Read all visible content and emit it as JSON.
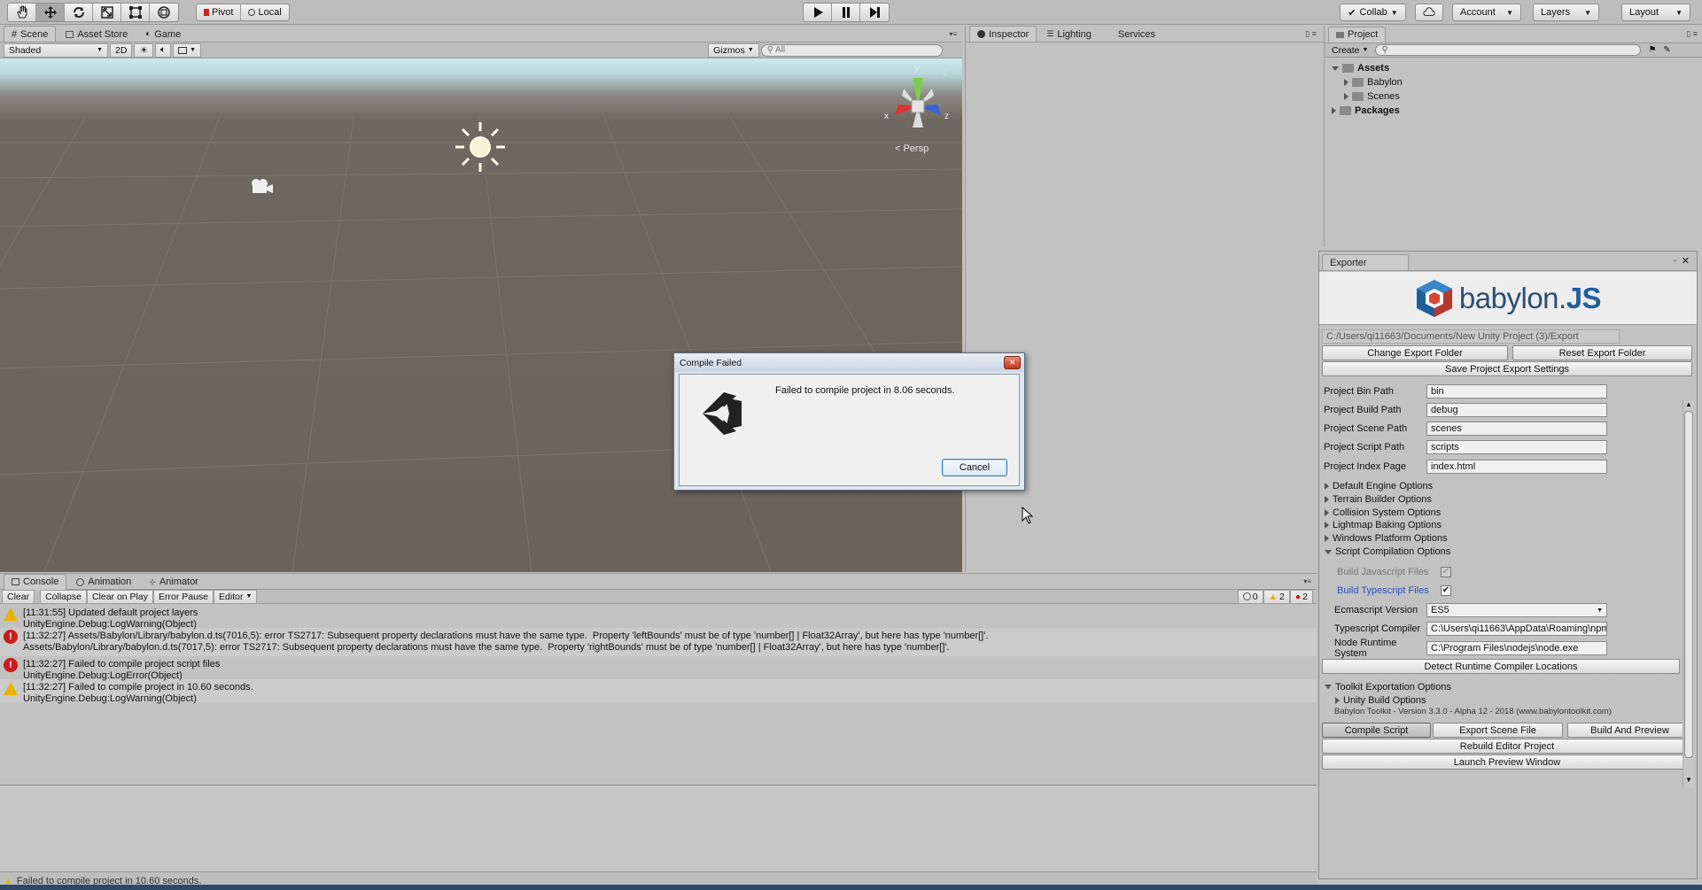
{
  "toolbar": {
    "pivot_label": "Pivot",
    "local_label": "Local",
    "collab_label": "Collab",
    "account_label": "Account",
    "layers_label": "Layers",
    "layout_label": "Layout"
  },
  "scene_tabs": {
    "scene": "Scene",
    "asset_store": "Asset Store",
    "game": "Game"
  },
  "scene_toolbar": {
    "shading": "Shaded",
    "mode_2d": "2D",
    "gizmos": "Gizmos",
    "search_placeholder": "All"
  },
  "scene_view": {
    "persp_label": "< Persp",
    "axis_x": "x",
    "axis_y": "y",
    "axis_z": "z"
  },
  "inspector_tabs": {
    "inspector": "Inspector",
    "lighting": "Lighting",
    "services": "Services"
  },
  "project": {
    "tab": "Project",
    "create_label": "Create",
    "tree": [
      {
        "label": "Assets",
        "bold": true,
        "open": true,
        "depth": 0
      },
      {
        "label": "Babylon",
        "bold": false,
        "open": false,
        "depth": 1
      },
      {
        "label": "Scenes",
        "bold": false,
        "open": false,
        "depth": 1
      },
      {
        "label": "Packages",
        "bold": true,
        "open": false,
        "depth": 0
      }
    ]
  },
  "exporter": {
    "tab": "Exporter",
    "logo_text_a": "babylon.",
    "logo_text_b": "JS",
    "export_path": "C:/Users/qi11663/Documents/New Unity Project (3)/Export",
    "change_folder": "Change Export Folder",
    "reset_folder": "Reset Export Folder",
    "save_settings": "Save Project Export Settings",
    "props": [
      {
        "label": "Project Bin Path",
        "value": "bin"
      },
      {
        "label": "Project Build Path",
        "value": "debug"
      },
      {
        "label": "Project Scene Path",
        "value": "scenes"
      },
      {
        "label": "Project Script Path",
        "value": "scripts"
      },
      {
        "label": "Project Index Page",
        "value": "index.html"
      }
    ],
    "foldouts": [
      "Default Engine Options",
      "Terrain Builder Options",
      "Collision System Options",
      "Lightmap Baking Options",
      "Windows Platform Options"
    ],
    "script_compilation": "Script Compilation Options",
    "build_js": "Build Javascript Files",
    "build_ts": "Build Typescript Files",
    "ecmascript_label": "Ecmascript Version",
    "ecmascript_value": "ES5",
    "ts_compiler_label": "Typescript Compiler",
    "ts_compiler_value": "C:\\Users\\qi11663\\AppData\\Roaming\\npm",
    "node_runtime_label": "Node Runtime System",
    "node_runtime_value": "C:\\Program Files\\nodejs\\node.exe",
    "detect_locations": "Detect Runtime Compiler Locations",
    "toolkit_options": "Toolkit Exportation Options",
    "unity_build_options": "Unity Build Options",
    "version": "Babylon Toolkit - Version 3.3.0 - Alpha 12 - 2018 (www.babylontoolkit.com)",
    "compile_script": "Compile Script",
    "export_scene": "Export Scene File",
    "build_preview": "Build And Preview",
    "rebuild_project": "Rebuild Editor Project",
    "launch_preview": "Launch Preview Window"
  },
  "console": {
    "tabs": {
      "console": "Console",
      "animation": "Animation",
      "animator": "Animator"
    },
    "buttons": {
      "clear": "Clear",
      "collapse": "Collapse",
      "clear_on_play": "Clear on Play",
      "error_pause": "Error Pause",
      "editor": "Editor"
    },
    "counts": {
      "info": "0",
      "warn": "2",
      "error": "2"
    },
    "entries": [
      {
        "type": "warn",
        "line1": "[11:31:55] Updated default project layers",
        "line2": "UnityEngine.Debug:LogWarning(Object)"
      },
      {
        "type": "error",
        "line1": "[11:32:27] Assets/Babylon/Library/babylon.d.ts(7016,5): error TS2717: Subsequent property declarations must have the same type.  Property 'leftBounds' must be of type 'number[] | Float32Array', but here has type 'number[]'.",
        "line2": "Assets/Babylon/Library/babylon.d.ts(7017,5): error TS2717: Subsequent property declarations must have the same type.  Property 'rightBounds' must be of type 'number[] | Float32Array', but here has type 'number[]'."
      },
      {
        "type": "error",
        "line1": "[11:32:27] Failed to compile project script files",
        "line2": "UnityEngine.Debug:LogError(Object)"
      },
      {
        "type": "warn",
        "line1": "[11:32:27] Failed to compile project in 10.60 seconds.",
        "line2": "UnityEngine.Debug:LogWarning(Object)"
      }
    ]
  },
  "status_bar": {
    "text": "Failed to compile project in 10.60 seconds."
  },
  "dialog": {
    "title": "Compile Failed",
    "message": "Failed to compile project in 8.06 seconds.",
    "cancel": "Cancel"
  },
  "colors": {
    "editor_bg": "#c2c2c2",
    "scene_ground": "#6c635b",
    "sky_top": "#cde9ee",
    "warn": "#e8b400",
    "error": "#cc1b1b",
    "babylon_blue": "#1e5f9e",
    "link_blue": "#2a52be"
  }
}
